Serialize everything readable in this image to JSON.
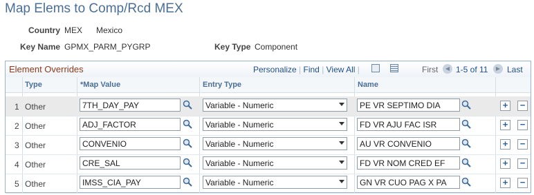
{
  "page": {
    "title": "Map Elems to Comp/Rcd MEX"
  },
  "header": {
    "country_label": "Country",
    "country_code": "MEX",
    "country_name": "Mexico",
    "keyname_label": "Key Name",
    "keyname_value": "GPMX_PARM_PYGRP",
    "keytype_label": "Key Type",
    "keytype_value": "Component"
  },
  "grid": {
    "title": "Element Overrides",
    "personalize": "Personalize",
    "find": "Find",
    "view_all": "View All",
    "first": "First",
    "range": "1-5 of 11",
    "last": "Last",
    "columns": {
      "type": "Type",
      "map_value": "*Map Value",
      "entry_type": "Entry Type",
      "name": "Name"
    },
    "rows": [
      {
        "num": "1",
        "type": "Other",
        "map_value": "7TH_DAY_PAY",
        "entry_type": "Variable - Numeric",
        "name": "PE VR SEPTIMO DIA"
      },
      {
        "num": "2",
        "type": "Other",
        "map_value": "ADJ_FACTOR",
        "entry_type": "Variable - Numeric",
        "name": "FD VR AJU FAC ISR"
      },
      {
        "num": "3",
        "type": "Other",
        "map_value": "CONVENIO",
        "entry_type": "Variable - Numeric",
        "name": "AU VR CONVENIO"
      },
      {
        "num": "4",
        "type": "Other",
        "map_value": "CRE_SAL",
        "entry_type": "Variable - Numeric",
        "name": "FD VR NOM CRED EF"
      },
      {
        "num": "5",
        "type": "Other",
        "map_value": "IMSS_CIA_PAY",
        "entry_type": "Variable - Numeric",
        "name": "GN VR CUO PAG X PA"
      }
    ]
  },
  "colors": {
    "title": "#4a6f96",
    "grid_title": "#8b3a1a",
    "link": "#1f4f8a",
    "row_alt": "#eaeaea"
  },
  "icons": [
    "lookup-icon",
    "download-icon",
    "grid-view-icon",
    "previous-arrow-icon",
    "next-arrow-icon",
    "add-row-icon",
    "delete-row-icon"
  ]
}
